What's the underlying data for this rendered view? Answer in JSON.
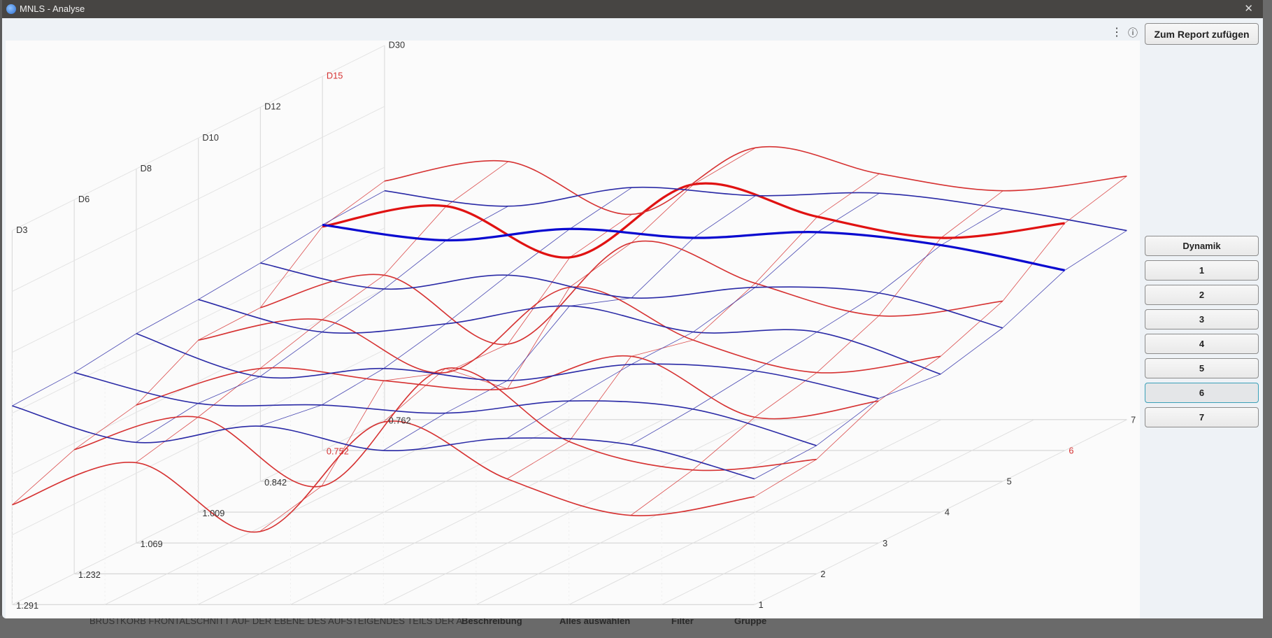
{
  "window": {
    "title": "MNLS - Analyse",
    "close_icon": "close-icon",
    "app_icon": "globe-icon"
  },
  "toolbar": {
    "more_icon": "kebab-menu-icon",
    "info_icon": "info-icon",
    "more_glyph": "⋮",
    "info_glyph": "ⓘ"
  },
  "panel": {
    "report_button": "Zum Report zufügen",
    "dynamik_button": "Dynamik",
    "row_buttons": [
      "1",
      "2",
      "3",
      "4",
      "5",
      "6",
      "7"
    ],
    "selected_row": "6"
  },
  "background_app": {
    "row_text": "BRUSTKORB FRONTALSCHNITT AUF DER EBENE DES AUFSTEIGENDES TEILS DER A",
    "buttons": [
      "Beschreibung",
      "Alles auswählen",
      "Filter",
      "Gruppe"
    ]
  },
  "chart_data": {
    "type": "surface",
    "columns": [
      "D3",
      "D6",
      "D8",
      "D10",
      "D12",
      "D15",
      "D30"
    ],
    "rows": [
      "1",
      "2",
      "3",
      "4",
      "5",
      "6",
      "7"
    ],
    "row_values": [
      "1.291",
      "1.232",
      "1.069",
      "1.009",
      "0.842",
      "0.752",
      "0.762"
    ],
    "highlighted_index": 5,
    "colors": {
      "red": "#d63232",
      "red_highlight": "#e01212",
      "blue": "#2a2aa6",
      "blue_highlight": "#0a0ad0",
      "highlight_label": "#d63232"
    },
    "series": [
      {
        "name": "red",
        "values": [
          [
            1.23,
            1.75,
            0.9,
            2.25,
            1.55,
            1.1,
            1.33
          ],
          [
            1.53,
            1.93,
            1.08,
            2.53,
            1.63,
            1.28,
            1.41
          ],
          [
            1.7,
            2.15,
            2.0,
            1.9,
            2.3,
            1.55,
            1.75
          ],
          [
            2.12,
            2.37,
            1.72,
            2.77,
            2.12,
            1.72,
            1.92
          ],
          [
            2.14,
            2.54,
            1.69,
            2.94,
            2.44,
            2.04,
            2.22
          ],
          [
            2.76,
            3.01,
            2.38,
            3.28,
            2.88,
            2.62,
            2.8
          ],
          [
            2.94,
            3.18,
            2.53,
            3.35,
            3.03,
            2.82,
            3.0
          ]
        ]
      },
      {
        "name": "blue",
        "values": [
          [
            2.45,
            2.0,
            2.2,
            1.9,
            2.05,
            1.97,
            1.55
          ],
          [
            2.48,
            2.1,
            2.08,
            1.98,
            2.13,
            2.03,
            1.58
          ],
          [
            2.58,
            2.05,
            2.15,
            2.0,
            2.2,
            2.12,
            1.78
          ],
          [
            2.62,
            2.22,
            2.32,
            2.54,
            2.22,
            2.22,
            1.7
          ],
          [
            2.69,
            2.37,
            2.54,
            2.26,
            2.39,
            2.32,
            1.89
          ],
          [
            2.78,
            2.59,
            2.73,
            2.62,
            2.69,
            2.53,
            2.22
          ],
          [
            2.82,
            2.63,
            2.86,
            2.76,
            2.79,
            2.6,
            2.33
          ]
        ]
      }
    ]
  }
}
